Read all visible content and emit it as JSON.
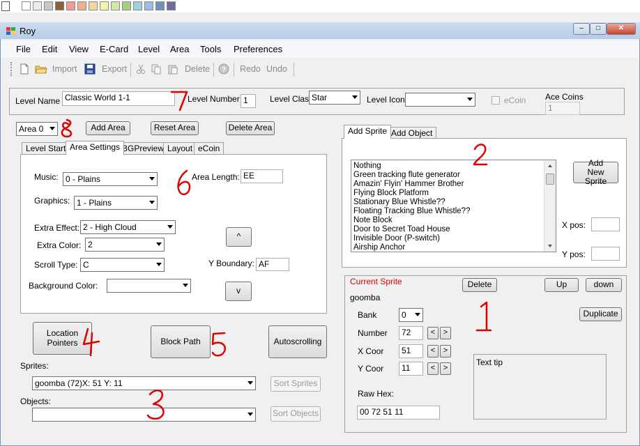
{
  "palette_colors": [
    "#ffffff",
    "#ececec",
    "#c8c8c8",
    "#a8a8a8",
    "#8c6239",
    "#f09b9b",
    "#f0b08a",
    "#f4d79c",
    "#f4f4a8",
    "#d2e9a6",
    "#a4d07d",
    "#9dd1dc",
    "#9cbde3",
    "#7090b8",
    "#6d6d9e"
  ],
  "window": {
    "title": "Roy",
    "controls": [
      "minimize",
      "maximize",
      "close"
    ]
  },
  "menu": {
    "items": [
      "File",
      "Edit",
      "View",
      "E-Card",
      "Level",
      "Area",
      "Tools",
      "Preferences"
    ]
  },
  "toolbar": {
    "import": "Import",
    "export": "Export",
    "delete": "Delete",
    "redo": "Redo",
    "undo": "Undo"
  },
  "level_bar": {
    "level_name_label": "Level Name",
    "level_name_value": "Classic World 1-1",
    "level_number_label": "Level Number",
    "level_number_value": "1",
    "level_class_label": "Level Class",
    "level_class_value": "Star",
    "level_icon_label": "Level Icon",
    "level_icon_value": "",
    "ecoin_label": "eCoin",
    "ace_coins_label": "Ace Coins",
    "ace_coins_value": "1"
  },
  "area_bar": {
    "area_select": "Area 0",
    "add_area": "Add Area",
    "reset_area": "Reset Area",
    "delete_area": "Delete Area"
  },
  "left_tabs": [
    "Level Start",
    "Area Settings",
    "BGPreview",
    "Layout",
    "eCoin"
  ],
  "area_settings": {
    "music_label": "Music:",
    "music_value": "0 - Plains",
    "graphics_label": "Graphics:",
    "graphics_value": "1 - Plains",
    "extra_effect_label": "Extra Effect:",
    "extra_effect_value": "2 - High Cloud",
    "extra_color_label": "Extra Color:",
    "extra_color_value": "2",
    "scroll_type_label": "Scroll Type:",
    "scroll_type_value": "C",
    "background_color_label": "Background Color:",
    "background_color_value": "",
    "area_length_label": "Area Length:",
    "area_length_value": "EE",
    "y_boundary_label": "Y Boundary:",
    "y_boundary_value": "AF",
    "up_button": "^",
    "down_button": "v"
  },
  "bottom_buttons": {
    "location_pointers": "Location Pointers",
    "block_path": "Block Path",
    "autoscrolling": "Autoscrolling"
  },
  "sprites_section": {
    "sprites_label": "Sprites:",
    "sprites_value": "goomba (72)X: 51 Y: 11",
    "sort_sprites": "Sort Sprites",
    "objects_label": "Objects:",
    "objects_value": "",
    "sort_objects": "Sort Objects"
  },
  "right_tabs": [
    "Add Sprite",
    "Add Object"
  ],
  "sprite_list": {
    "items": [
      "Nothing",
      "Green tracking flute generator",
      "Amazin' Flyin' Hammer Brother",
      "Flying Block Platform",
      "Stationary Blue Whistle??",
      "Floating Tracking Blue Whistle??",
      "Note Block",
      "Door to Secret Toad House",
      "Invisible Door (P-switch)",
      "Airship Anchor"
    ],
    "add_new_sprite": "Add New Sprite",
    "x_pos_label": "X pos:",
    "y_pos_label": "Y pos:",
    "x_pos_value": "",
    "y_pos_value": ""
  },
  "current_sprite": {
    "title": "Current Sprite",
    "title_color": "#e00000",
    "name": "goomba",
    "delete": "Delete",
    "up": "Up",
    "down": "down",
    "duplicate": "Duplicate",
    "bank_label": "Bank",
    "bank_value": "0",
    "number_label": "Number",
    "number_value": "72",
    "x_coor_label": "X Coor",
    "x_coor_value": "51",
    "y_coor_label": "Y Coor",
    "y_coor_value": "11",
    "prev_symbol": "<",
    "next_symbol": ">",
    "text_tip": "Text tip",
    "raw_hex_label": "Raw Hex:",
    "raw_hex_value": "00 72 51 11"
  },
  "annotations": {
    "color": "#e00000",
    "numbers": [
      "1",
      "2",
      "3",
      "4",
      "5",
      "6",
      "7",
      "8"
    ]
  }
}
